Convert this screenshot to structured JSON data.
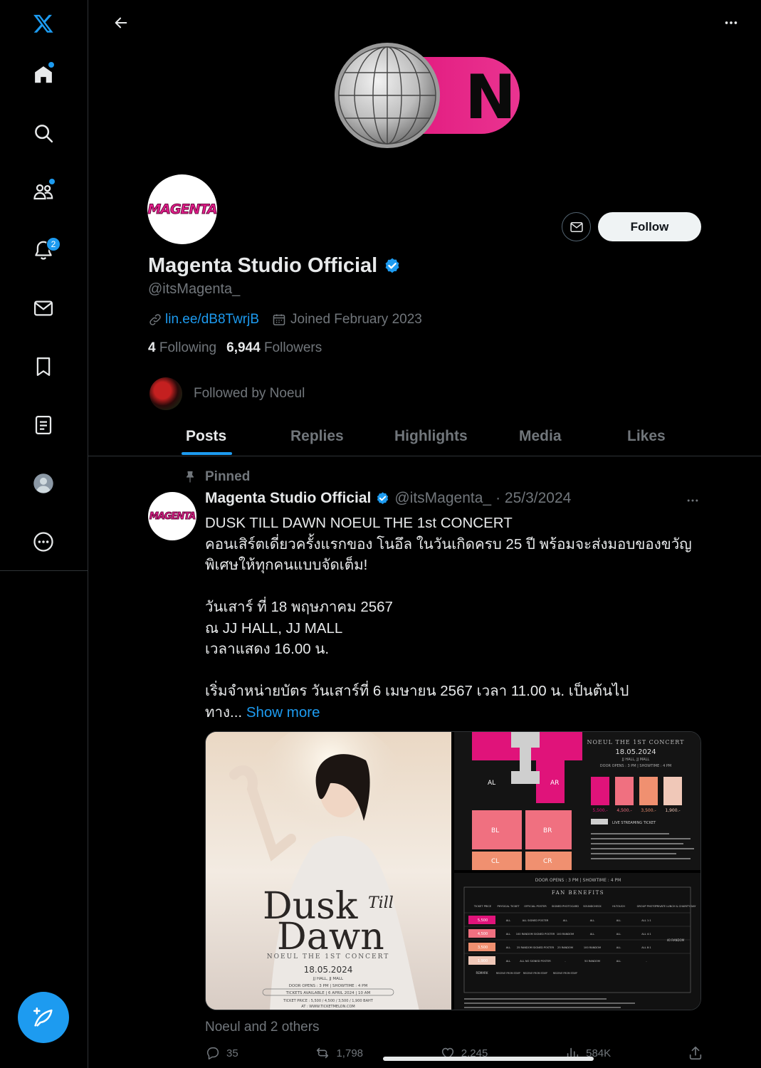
{
  "nav": {
    "items": [
      {
        "name": "x-logo-icon"
      },
      {
        "name": "home-icon"
      },
      {
        "name": "search-icon"
      },
      {
        "name": "communities-icon"
      },
      {
        "name": "notifications-icon",
        "badge": "2"
      },
      {
        "name": "messages-icon"
      },
      {
        "name": "bookmarks-icon"
      },
      {
        "name": "lists-icon"
      },
      {
        "name": "profile-icon"
      },
      {
        "name": "more-icon"
      }
    ]
  },
  "banner": {
    "letter": "N",
    "accent": "#e0137a"
  },
  "profile": {
    "avatar_text": "MAGENTA",
    "name": "Magenta Studio Official",
    "handle": "@itsMagenta_",
    "link": "lin.ee/dB8TwrjB",
    "joined": "Joined February 2023",
    "following_count": "4",
    "following_label": "Following",
    "followers_count": "6,944",
    "followers_label": "Followers",
    "followed_by": "Followed by Noeul",
    "follow_label": "Follow"
  },
  "tabs": [
    "Posts",
    "Replies",
    "Highlights",
    "Media",
    "Likes"
  ],
  "post": {
    "pinned_label": "Pinned",
    "author": "Magenta Studio Official",
    "handle": "@itsMagenta_",
    "date": "· 25/3/2024",
    "lines": [
      "DUSK TILL DAWN NOEUL THE 1st CONCERT",
      "คอนเสิร์ตเดี่ยวครั้งแรกของ โนอึล ในวันเกิดครบ 25 ปี พร้อมจะส่งมอบของขวัญ",
      "พิเศษให้ทุกคนแบบจัดเต็ม!",
      "",
      "วันเสาร์ ที่ 18 พฤษภาคม 2567",
      "ณ JJ HALL, JJ MALL",
      "เวลาแสดง 16.00 น.",
      "",
      "เริ่มจำหน่ายบัตร วันเสาร์ที่ 6 เมษายน 2567 เวลา 11.00 น. เป็นต้นไป"
    ],
    "last_line": "ทาง...",
    "show_more": "Show more",
    "poster": {
      "title1": "Dusk",
      "title_small": "Till",
      "title2": "Dawn",
      "subtitle": "NOEUL THE 1ST CONCERT",
      "date": "18.05.2024",
      "venue": "JJ HALL, JJ MALL",
      "doors": "DOOR OPENS : 3 PM | SHOWTIME : 4 PM",
      "tickets": "TICKETS AVAILABLE | 6 APRIL 2024 | 10 AM",
      "prices": "TICKET PRICE : 5,500 / 4,500 / 3,500 / 1,900 BAHT",
      "site": "AT : WWW.TICKETMELON.COM"
    },
    "seatmap": {
      "heading": "NOEUL THE 1ST CONCERT",
      "date": "18.05.2024",
      "venue": "JJ HALL, JJ MALL",
      "doors": "DOOR OPENS : 3 PM | SHOWTIME : 4 PM",
      "zones": [
        "AL",
        "AR",
        "BL",
        "BR",
        "CL",
        "CR"
      ],
      "price_tiers": [
        "5,500.-",
        "4,500.-",
        "3,500.-",
        "1,900.-"
      ],
      "tier_colors": [
        "#e0137a",
        "#f07080",
        "#f09070",
        "#f0c8b8"
      ],
      "live": "LIVE STREAMING TICKET"
    },
    "benefits": {
      "doors": "DOOR OPENS : 3 PM | SHOWTIME : 4 PM",
      "title": "FAN BENEFITS",
      "headers": [
        "TICKET PRICE",
        "PHYSICAL TICKET",
        "OFFICIAL POSTER",
        "SIGNED PHOTOCARD",
        "SOUNDCHECK",
        "HI-TOUCH",
        "GROUP PHOTO",
        "PRIVATE LUNCH & CHARITY DAY"
      ],
      "rows": [
        [
          "5,500",
          "ALL",
          "ALL SIGNED POSTER",
          "ALL",
          "ALL",
          "ALL",
          "ALL 1:1"
        ],
        [
          "4,500",
          "ALL",
          "100 RANDOM SIGNED POSTER",
          "100 RANDOM",
          "ALL",
          "ALL",
          "ALL 4:1"
        ],
        [
          "3,500",
          "ALL",
          "25 RANDOM SIGNED POSTER",
          "25 RANDOM",
          "100 RANDOM",
          "ALL",
          "ALL 8:1"
        ],
        [
          "1,900",
          "ALL",
          "ALL NO SIGNED POSTER",
          "-",
          "50 RANDOM",
          "ALL",
          "-"
        ]
      ],
      "remark": "REMARK",
      "receive": "RECEIVE FROM STAFF",
      "random40": "40 RANDOM"
    },
    "liked_by": "Noeul and 2 others",
    "replies": "35",
    "reposts": "1,798",
    "likes": "2,245",
    "views": "584K"
  }
}
